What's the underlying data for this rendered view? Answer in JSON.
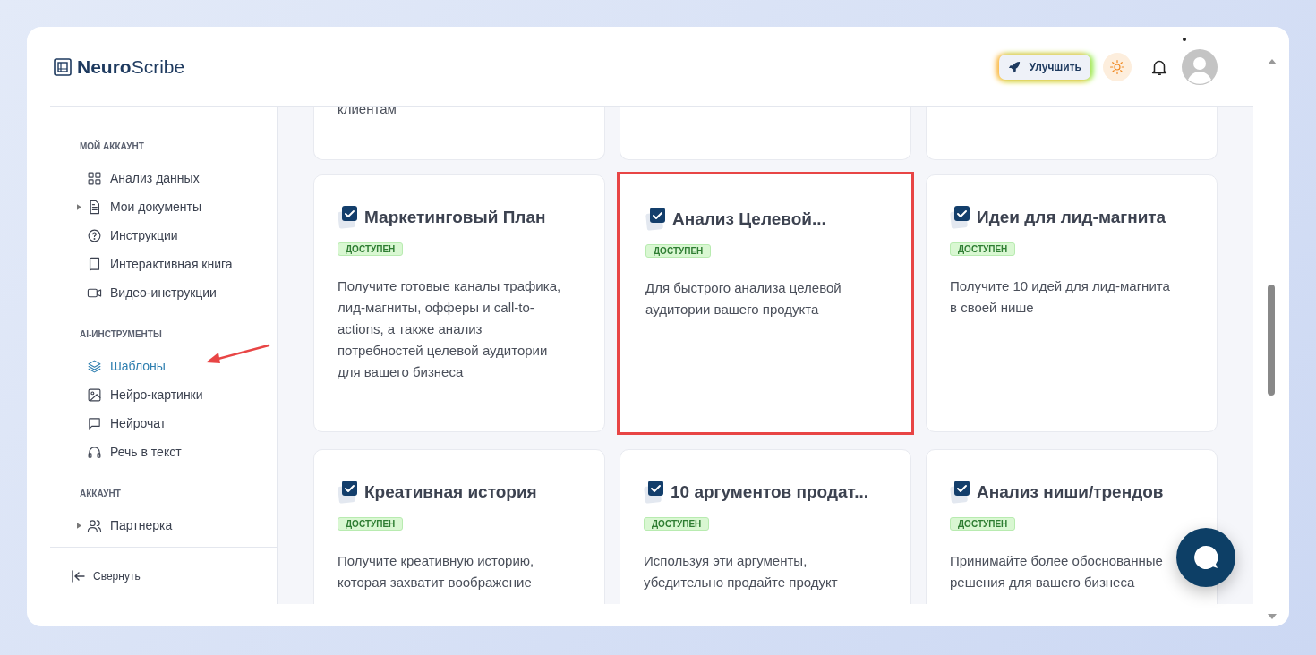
{
  "header": {
    "logo_bold": "Neuro",
    "logo_rest": "Scribe",
    "upgrade_button": "Улучшить"
  },
  "sidebar": {
    "sections": [
      {
        "title": "МОЙ АККАУНТ",
        "items": [
          {
            "label": "Анализ данных",
            "selected": false
          },
          {
            "label": "Мои документы",
            "selected": false,
            "expanded": false
          },
          {
            "label": "Инструкции",
            "selected": false
          },
          {
            "label": "Интерактивная книга",
            "selected": false
          },
          {
            "label": "Видео-инструкции",
            "selected": false
          }
        ]
      },
      {
        "title": "AI-ИНСТРУМЕНТЫ",
        "items": [
          {
            "label": "Шаблоны",
            "selected": true
          },
          {
            "label": "Нейро-картинки",
            "selected": false
          },
          {
            "label": "Нейрочат",
            "selected": false
          },
          {
            "label": "Речь в текст",
            "selected": false
          }
        ]
      },
      {
        "title": "АККАУНТ",
        "items": [
          {
            "label": "Партнерка",
            "selected": false,
            "expanded": false
          }
        ]
      }
    ],
    "collapse": "Свернуть"
  },
  "top_row_text": "клиентам",
  "templates": [
    {
      "title": "Маркетинговый План",
      "badge": "ДОСТУПЕН",
      "description": "Получите готовые каналы трафика, лид-магниты, офферы и call-to-actions, а также анализ потребностей целевой аудитории для вашего бизнеса",
      "selected": false
    },
    {
      "title": "Анализ Целевой...",
      "badge": "ДОСТУПЕН",
      "description": "Для быстрого анализа целевой аудитории вашего продукта",
      "selected": true
    },
    {
      "title": "Идеи для лид-магнита",
      "badge": "ДОСТУПЕН",
      "description": "Получите 10 идей для лид-магнита в своей нише",
      "selected": false
    },
    {
      "title": "Креативная история",
      "badge": "ДОСТУПЕН",
      "description": "Получите креативную историю, которая захватит воображение",
      "selected": false
    },
    {
      "title": "10 аргументов продат...",
      "badge": "ДОСТУПЕН",
      "description": "Используя эти аргументы, убедительно продайте продукт",
      "selected": false
    },
    {
      "title": "Анализ ниши/трендов",
      "badge": "ДОСТУПЕН",
      "description": "Принимайте более обоснованные решения для вашего бизнеса",
      "selected": false
    }
  ]
}
